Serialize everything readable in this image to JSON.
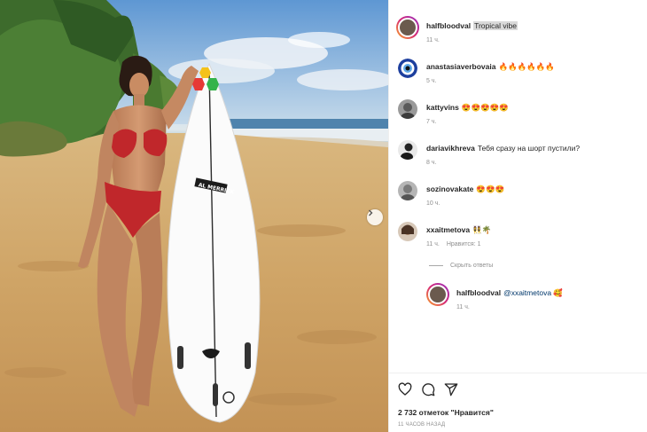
{
  "post": {
    "caption": {
      "username": "halfbloodval",
      "text": "Tropical vibe",
      "time": "11 ч."
    },
    "comments": [
      {
        "username": "anastasiaverbovaia",
        "text": "🔥🔥🔥🔥🔥🔥",
        "time": "5 ч.",
        "avatar_icon": "evil-eye-avatar"
      },
      {
        "username": "kattyvins",
        "text": "😍😍😍😍😍",
        "time": "7 ч.",
        "avatar_icon": "user-avatar"
      },
      {
        "username": "dariavikhreva",
        "text": "Тебя сразу на шорт пустили?",
        "time": "8 ч.",
        "avatar_icon": "user-avatar"
      },
      {
        "username": "sozinovakate",
        "text": "😍😍😍",
        "time": "10 ч.",
        "avatar_icon": "user-avatar"
      },
      {
        "username": "xxaitmetova",
        "text": "👯‍♀️🌴",
        "time": "11 ч.",
        "likes_label": "Нравится: 1",
        "avatar_icon": "user-avatar"
      }
    ],
    "hide_replies_label": "Скрыть ответы",
    "reply": {
      "username": "halfbloodval",
      "mention": "@xxaitmetova",
      "text": "🥰",
      "time": "11 ч."
    },
    "likes_text": "2 732 отметок \"Нравится\"",
    "time_ago": "11 ЧАСОВ НАЗАД"
  },
  "colors": {
    "text": "#262626",
    "secondary": "#8e8e8e",
    "mention": "#00376b",
    "story_ring": [
      "#f9a825",
      "#d62976",
      "#962fbf"
    ]
  },
  "icons": {
    "like": "heart-icon",
    "comment": "comment-icon",
    "share": "paper-plane-icon",
    "carousel_next": "chevron-right-icon"
  }
}
